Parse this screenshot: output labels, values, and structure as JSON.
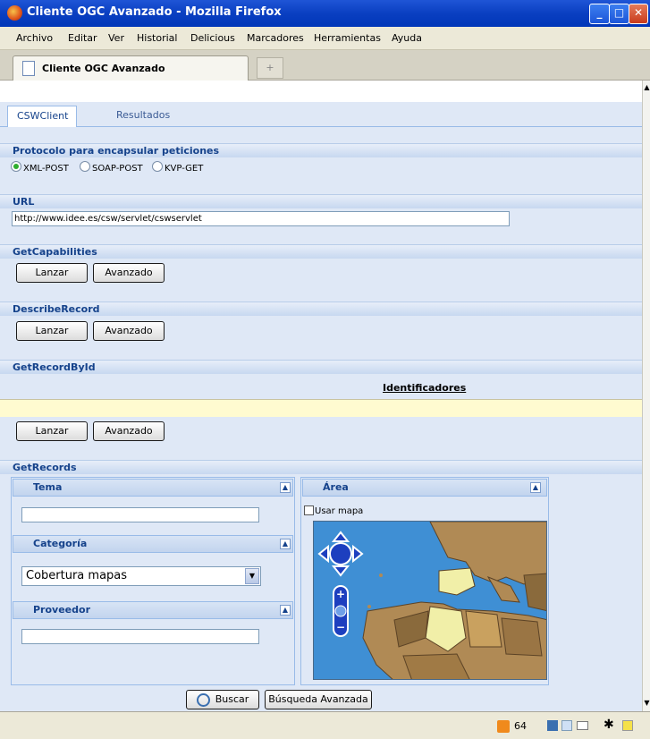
{
  "window": {
    "title": "Cliente OGC Avanzado - Mozilla Firefox"
  },
  "menu": [
    "Archivo",
    "Editar",
    "Ver",
    "Historial",
    "Delicious",
    "Marcadores",
    "Herramientas",
    "Ayuda"
  ],
  "browser_tab": {
    "label": "Cliente OGC Avanzado"
  },
  "app_tabs": {
    "active": "CSWClient",
    "other": "Resultados"
  },
  "protocol": {
    "header": "Protocolo para encapsular peticiones",
    "options": [
      "XML-POST",
      "SOAP-POST",
      "KVP-GET"
    ],
    "selected": "XML-POST"
  },
  "url": {
    "header": "URL",
    "value": "http://www.idee.es/csw/servlet/cswservlet"
  },
  "sections": {
    "getcapabilities": "GetCapabilities",
    "describerecord": "DescribeRecord",
    "getrecordbyid": "GetRecordById",
    "getrecords": "GetRecords"
  },
  "buttons": {
    "lanzar": "Lanzar",
    "avanzado": "Avanzado",
    "buscar": "Buscar",
    "busqueda_avanzada": "Búsqueda Avanzada"
  },
  "identificadores": "Identificadores",
  "getrecords": {
    "tema": "Tema",
    "categoria": "Categoría",
    "categoria_value": "Cobertura mapas",
    "proveedor": "Proveedor",
    "area": "Área",
    "usar_mapa": "Usar mapa"
  },
  "status": {
    "rss_count": "64"
  },
  "colors": {
    "titlebar": "#0a3fc1",
    "panel_bg": "#dfe8f6",
    "header_text": "#15428b",
    "map_sea": "#3f8fd4",
    "map_land": "#b08a55"
  }
}
